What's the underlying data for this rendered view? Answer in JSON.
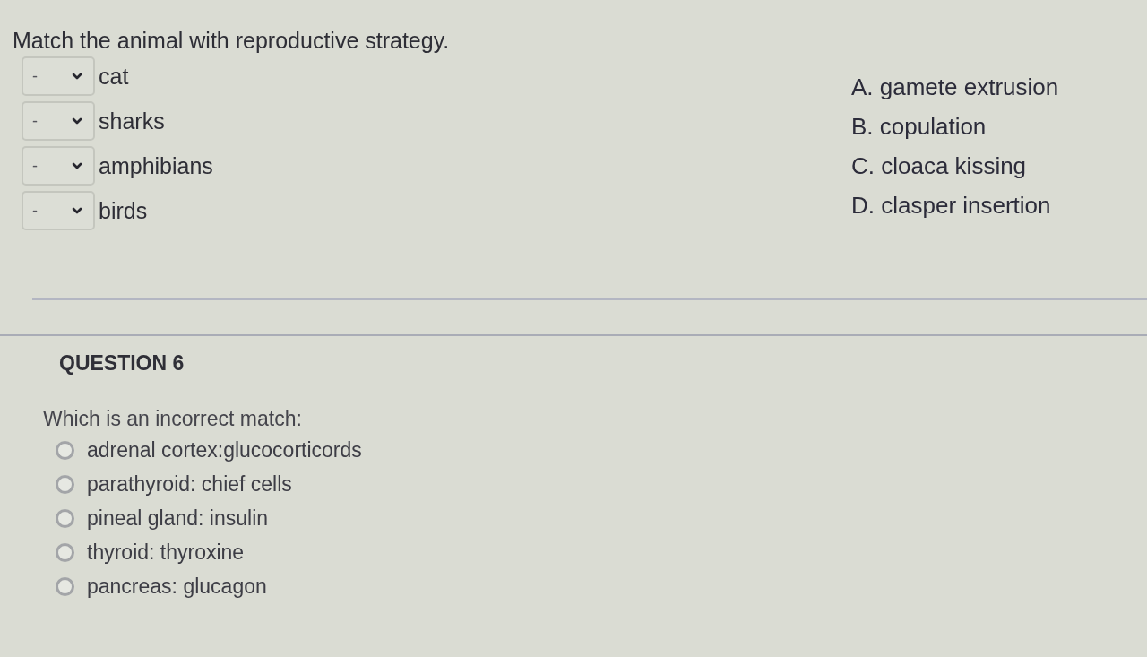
{
  "matching": {
    "prompt": "Match the animal with reproductive strategy.",
    "items": [
      {
        "value": "-",
        "label": "cat"
      },
      {
        "value": "-",
        "label": "sharks"
      },
      {
        "value": "-",
        "label": "amphibians"
      },
      {
        "value": "-",
        "label": "birds"
      }
    ],
    "options": [
      "A. gamete extrusion",
      "B. copulation",
      "C. cloaca kissing",
      "D. clasper insertion"
    ]
  },
  "question": {
    "heading": "QUESTION 6",
    "prompt": "Which is an incorrect match:",
    "choices": [
      {
        "label": "adrenal cortex:glucocorticords",
        "selected": false
      },
      {
        "label": "parathyroid: chief cells",
        "selected": false
      },
      {
        "label": "pineal gland: insulin",
        "selected": false
      },
      {
        "label": "thyroid: thyroxine",
        "selected": false
      },
      {
        "label": "pancreas: glucagon",
        "selected": false
      }
    ]
  }
}
